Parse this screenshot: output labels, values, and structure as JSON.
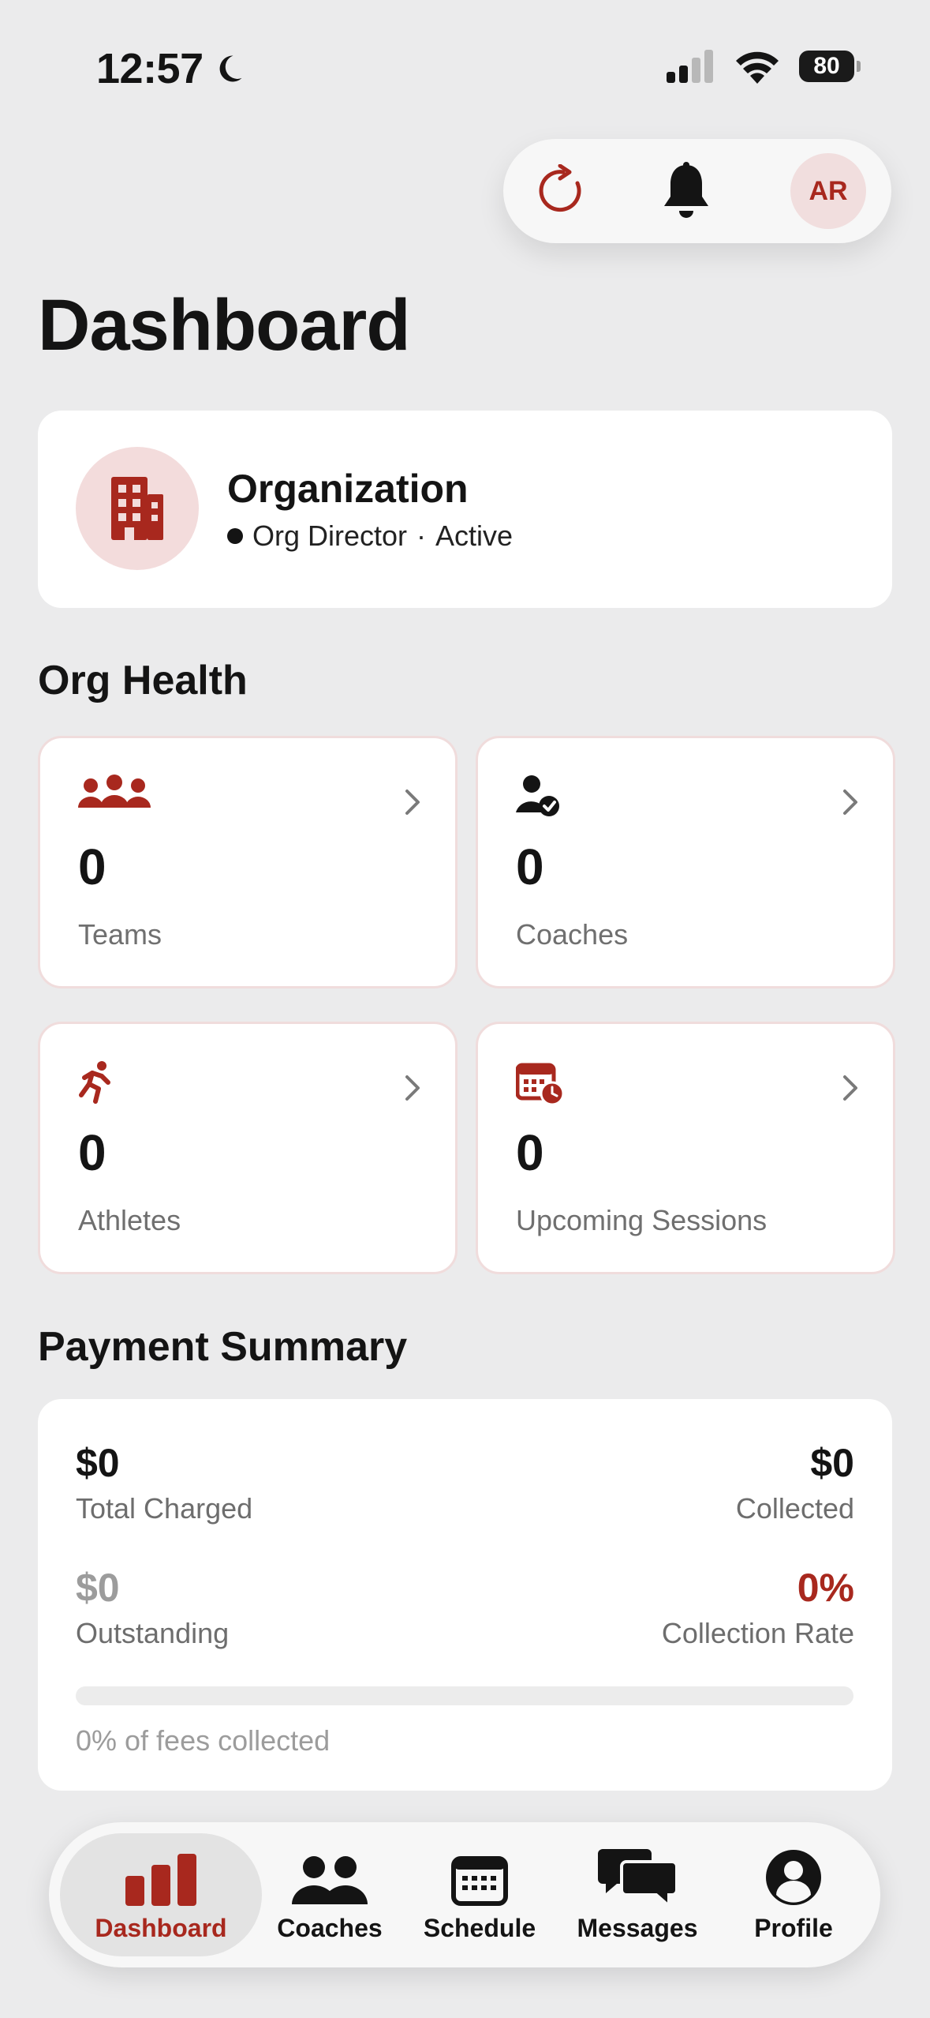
{
  "status_bar": {
    "time": "12:57",
    "battery": "80"
  },
  "header": {
    "avatar_initials": "AR",
    "title": "Dashboard"
  },
  "organization": {
    "name": "Organization",
    "role": "Org Director",
    "separator": "·",
    "status": "Active"
  },
  "org_health": {
    "title": "Org Health",
    "stats": [
      {
        "value": "0",
        "label": "Teams",
        "icon": "team-icon"
      },
      {
        "value": "0",
        "label": "Coaches",
        "icon": "coach-badge-icon"
      },
      {
        "value": "0",
        "label": "Athletes",
        "icon": "running-athlete-icon"
      },
      {
        "value": "0",
        "label": "Upcoming Sessions",
        "icon": "calendar-clock-icon"
      }
    ]
  },
  "payment_summary": {
    "title": "Payment Summary",
    "total_charged": {
      "value": "$0",
      "label": "Total Charged"
    },
    "collected": {
      "value": "$0",
      "label": "Collected"
    },
    "outstanding": {
      "value": "$0",
      "label": "Outstanding"
    },
    "collection_rate": {
      "value": "0%",
      "label": "Collection Rate"
    },
    "progress_percent": 0,
    "progress_caption": "0% of fees collected"
  },
  "tabbar": {
    "items": [
      {
        "label": "Dashboard",
        "icon": "bar-chart-icon",
        "active": true
      },
      {
        "label": "Coaches",
        "icon": "people-icon",
        "active": false
      },
      {
        "label": "Schedule",
        "icon": "calendar-icon",
        "active": false
      },
      {
        "label": "Messages",
        "icon": "chat-bubbles-icon",
        "active": false
      },
      {
        "label": "Profile",
        "icon": "person-circle-icon",
        "active": false
      }
    ]
  },
  "colors": {
    "accent": "#a8281e",
    "background": "#ebebec",
    "card": "#ffffff",
    "muted_text": "#6f6f6f"
  }
}
